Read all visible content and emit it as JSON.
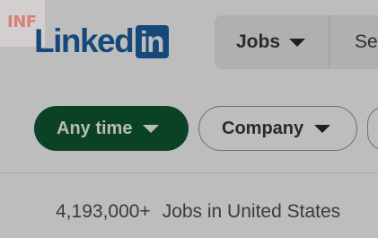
{
  "badge": {
    "text": "INF"
  },
  "logo": {
    "word": "Linked",
    "box_text": "in"
  },
  "nav": {
    "jobs_label": "Jobs",
    "search_label": "Se"
  },
  "filters": [
    {
      "label": "Any time",
      "active": true
    },
    {
      "label": "Company",
      "active": false
    }
  ],
  "results": {
    "count": "4,193,000+",
    "label": "Jobs in United States"
  },
  "colors": {
    "brand": "#15497a",
    "active_filter": "#0b4226",
    "overlay_bg": "#bdbdbd"
  }
}
